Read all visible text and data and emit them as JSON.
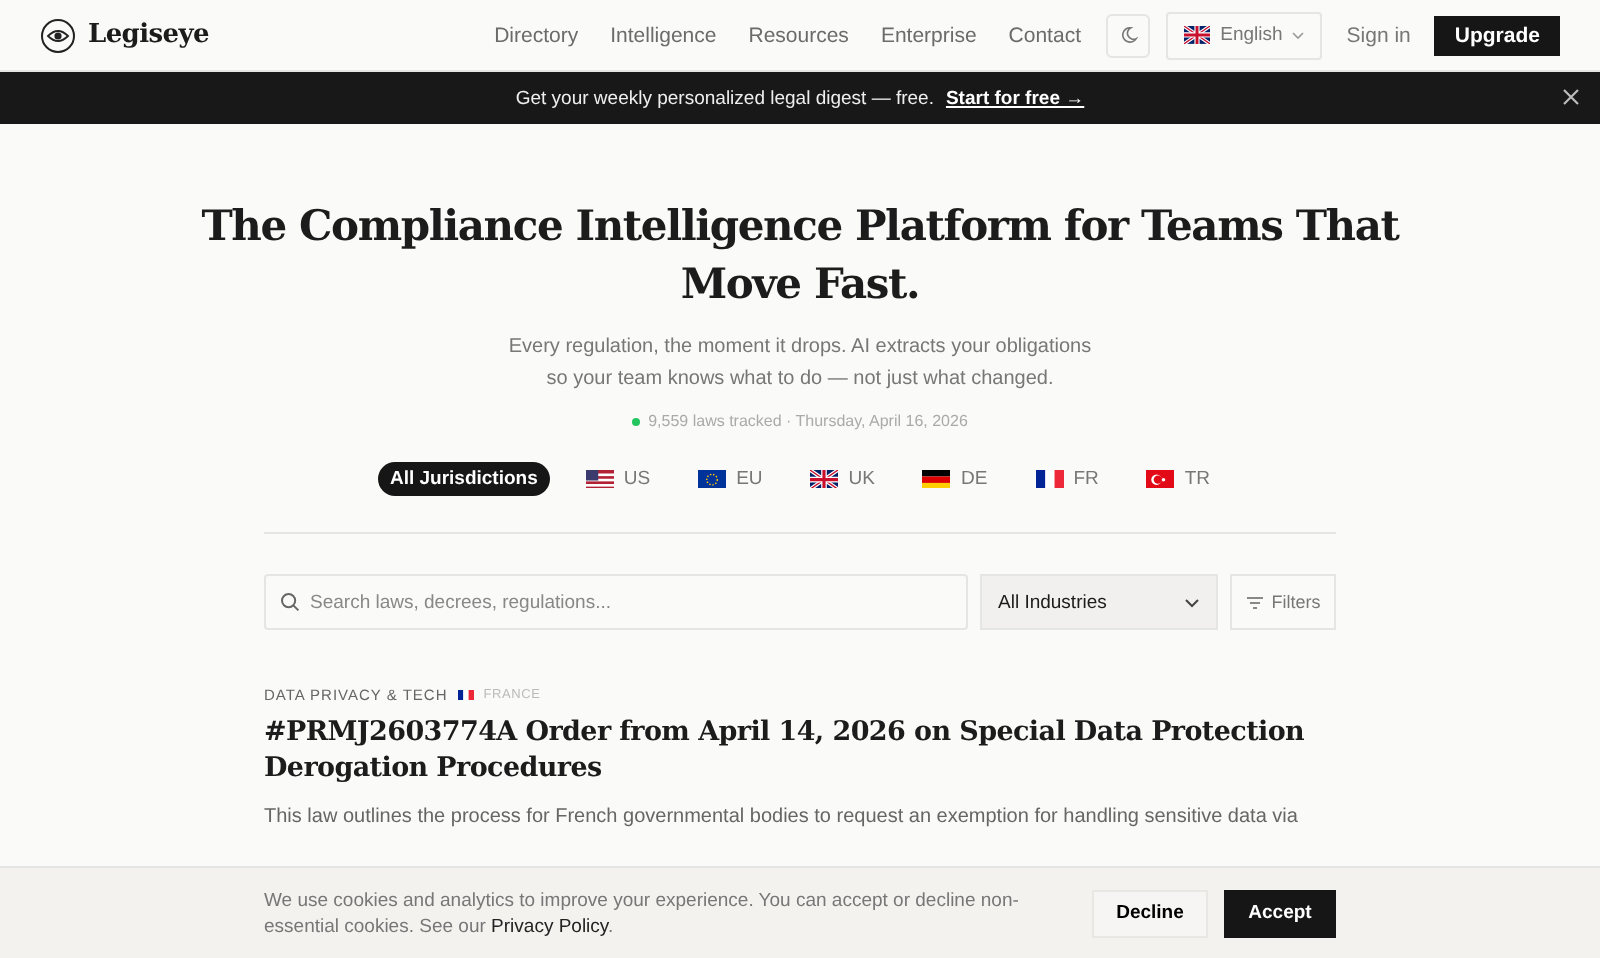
{
  "header": {
    "logo": "Legiseye",
    "nav": [
      "Directory",
      "Intelligence",
      "Resources",
      "Enterprise",
      "Contact"
    ],
    "language": "English",
    "sign_in": "Sign in",
    "upgrade": "Upgrade"
  },
  "banner": {
    "text": "Get your weekly personalized legal digest — free.",
    "link": "Start for free →"
  },
  "hero": {
    "title": "The Compliance Intelligence Platform for Teams That Move Fast.",
    "subtitle": "Every regulation, the moment it drops. AI extracts your obligations so your team knows what to do — not just what changed.",
    "status": "9,559 laws tracked · Thursday, April 16, 2026"
  },
  "jurisdictions": [
    {
      "label": "All Jurisdictions",
      "kind": "all",
      "selected": true
    },
    {
      "label": "US",
      "kind": "us",
      "selected": false
    },
    {
      "label": "EU",
      "kind": "eu",
      "selected": false
    },
    {
      "label": "UK",
      "kind": "uk",
      "selected": false
    },
    {
      "label": "DE",
      "kind": "de",
      "selected": false
    },
    {
      "label": "FR",
      "kind": "fr",
      "selected": false
    },
    {
      "label": "TR",
      "kind": "tr",
      "selected": false
    }
  ],
  "search": {
    "placeholder": "Search laws, decrees, regulations..."
  },
  "industry": {
    "value": "All Industries"
  },
  "filters": "Filters",
  "article": {
    "category": "DATA PRIVACY & TECH",
    "country": "FRANCE",
    "title": "#PRMJ2603774A Order from April 14, 2026 on Special Data Protection Derogation Procedures",
    "summary": "This law outlines the process for French governmental bodies to request an exemption for handling sensitive data via"
  },
  "cookie": {
    "text": "We use cookies and analytics to improve your experience. You can accept or decline non-essential cookies. See our",
    "link": "Privacy Policy",
    "end": ".",
    "decline": "Decline",
    "accept": "Accept"
  }
}
